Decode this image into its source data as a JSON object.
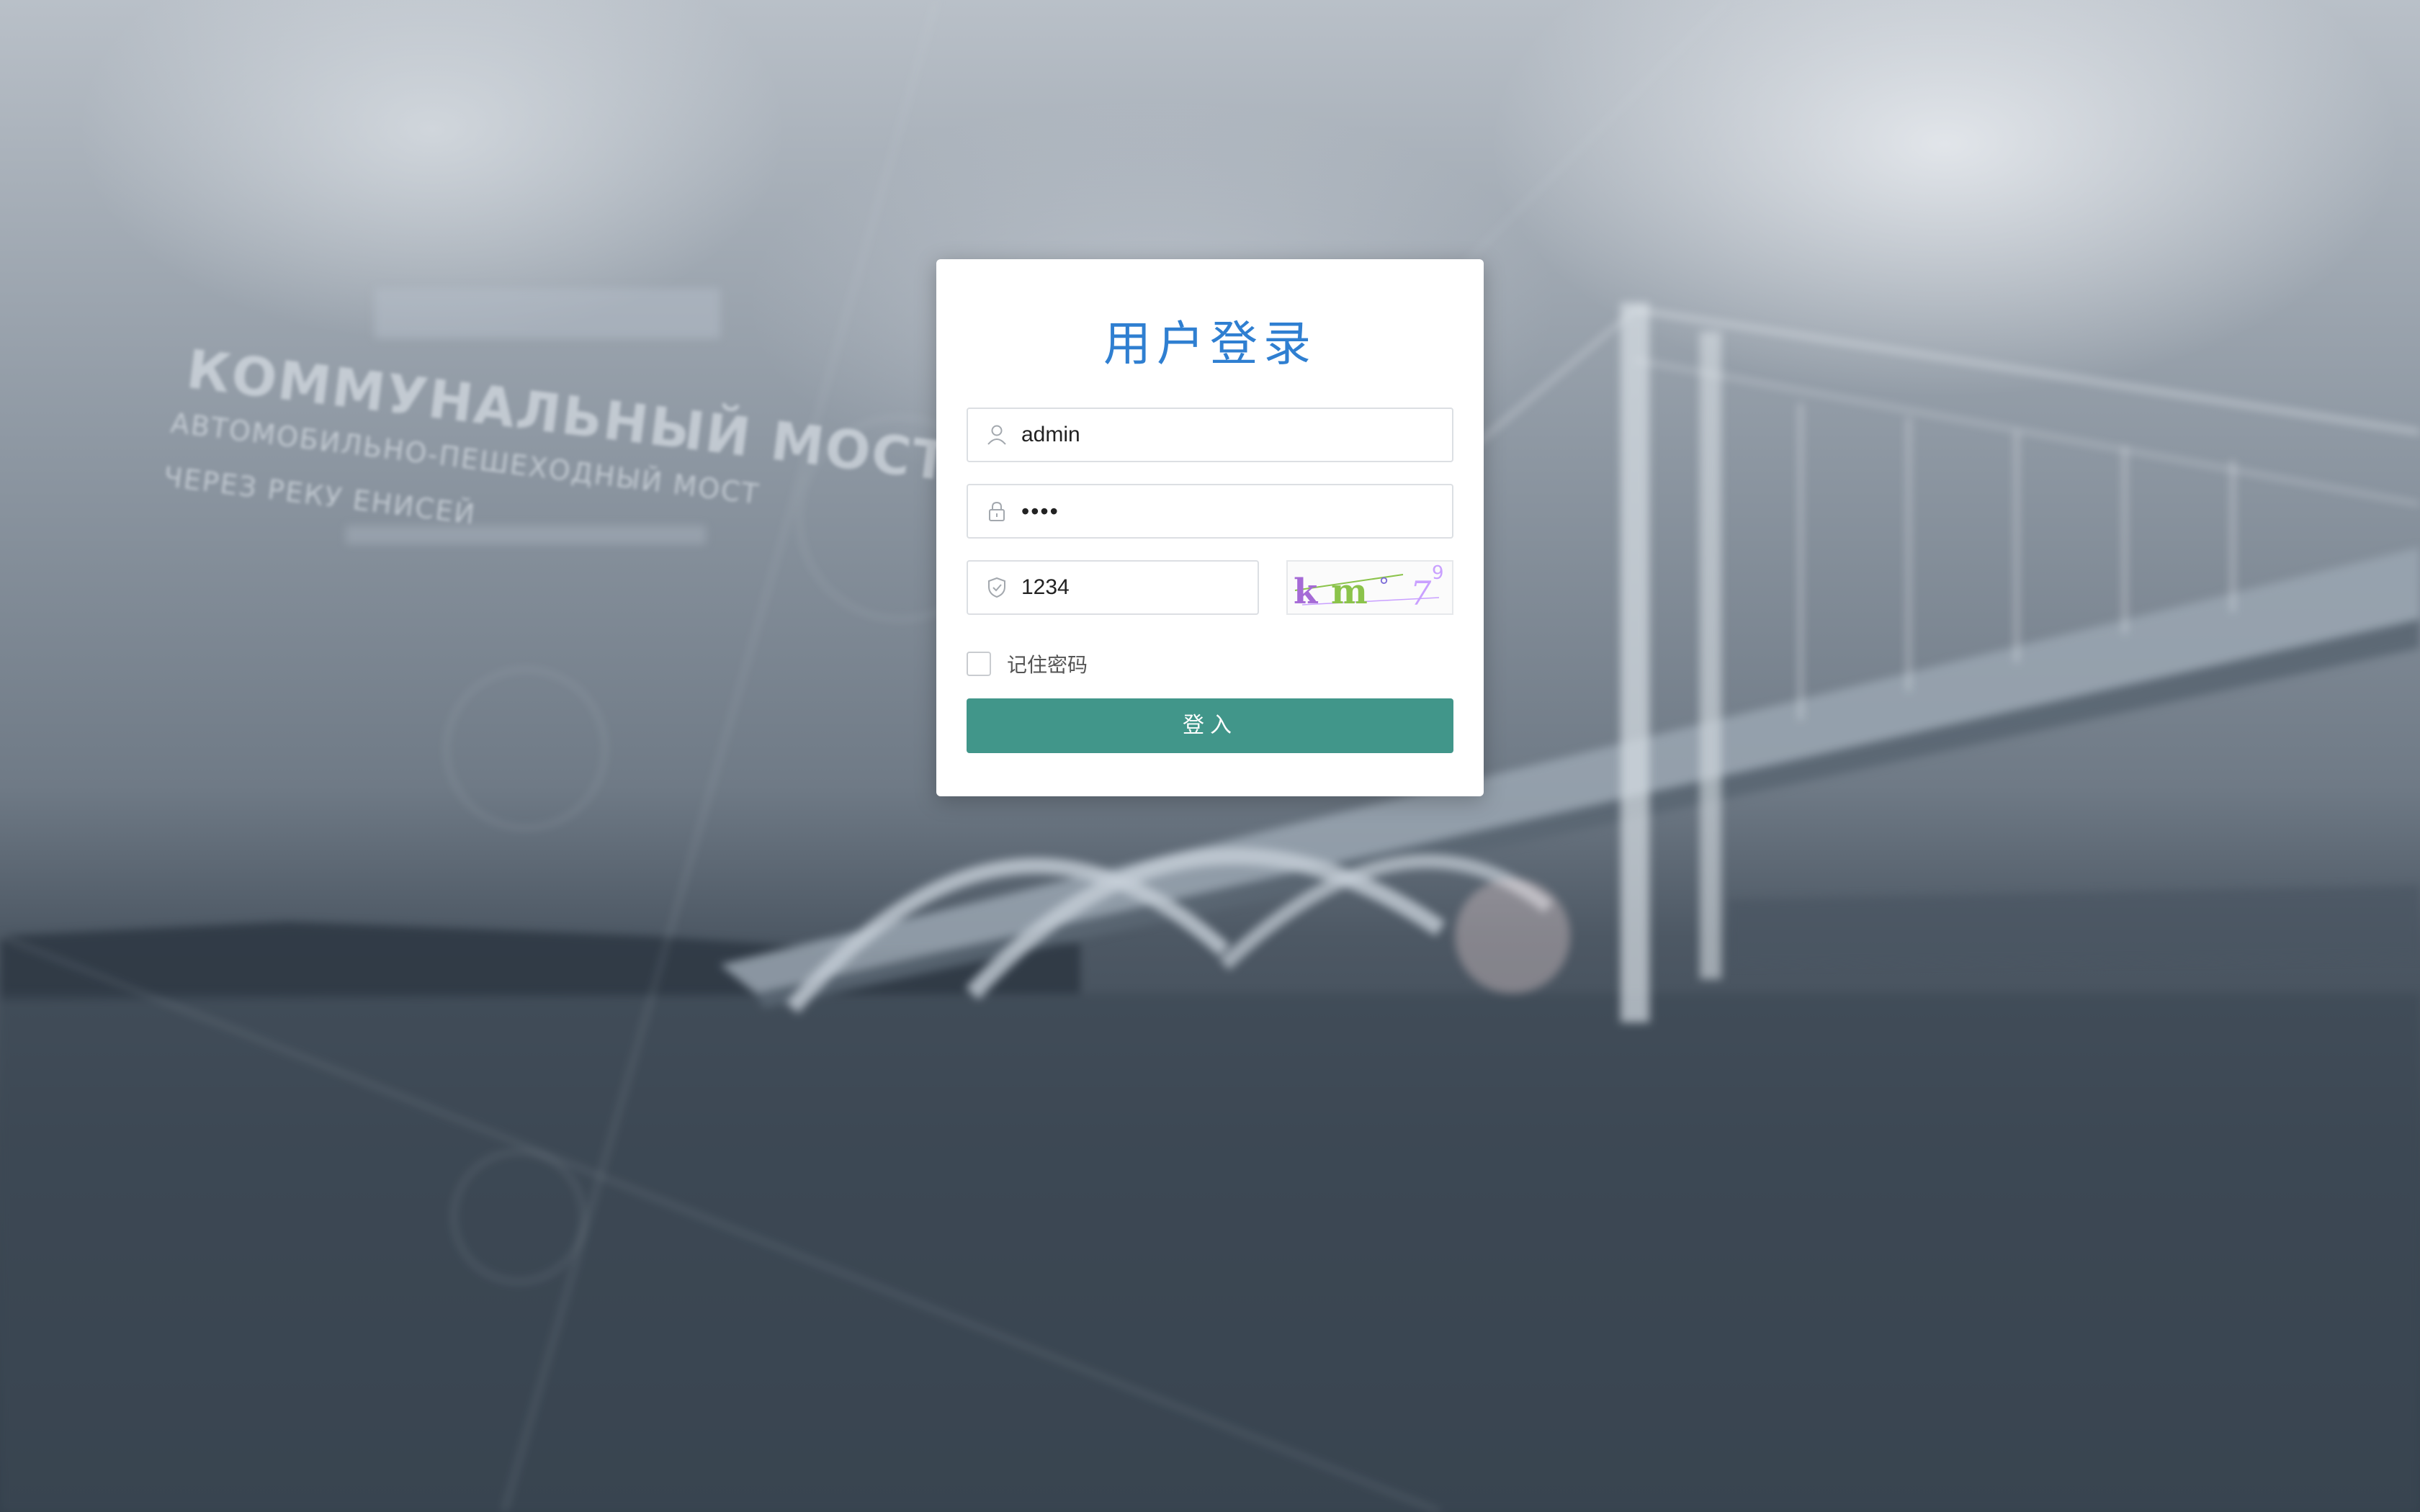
{
  "background": {
    "caption_line1": "КОММУНАЛЬНЫЙ МОСТ",
    "caption_line2": "АВТОМОБИЛЬНО-ПЕШЕХОДНЫЙ МОСТ",
    "caption_line3": "ЧЕРЕЗ РЕКУ ЕНИСЕЙ"
  },
  "login": {
    "title": "用户登录",
    "username_value": "admin",
    "password_value": "••••",
    "code_value": "1234",
    "captcha_text": "km°7",
    "captcha_colors": [
      "#a56ad6",
      "#8bc34a",
      "#c9a0ff",
      "#7c6cd8"
    ],
    "remember_label": "记住密码",
    "submit_label": "登入",
    "accent_color": "#2f7fd1",
    "button_color": "#41968a"
  },
  "icons": {
    "username": "user-icon",
    "password": "lock-icon",
    "code": "shield-icon"
  }
}
